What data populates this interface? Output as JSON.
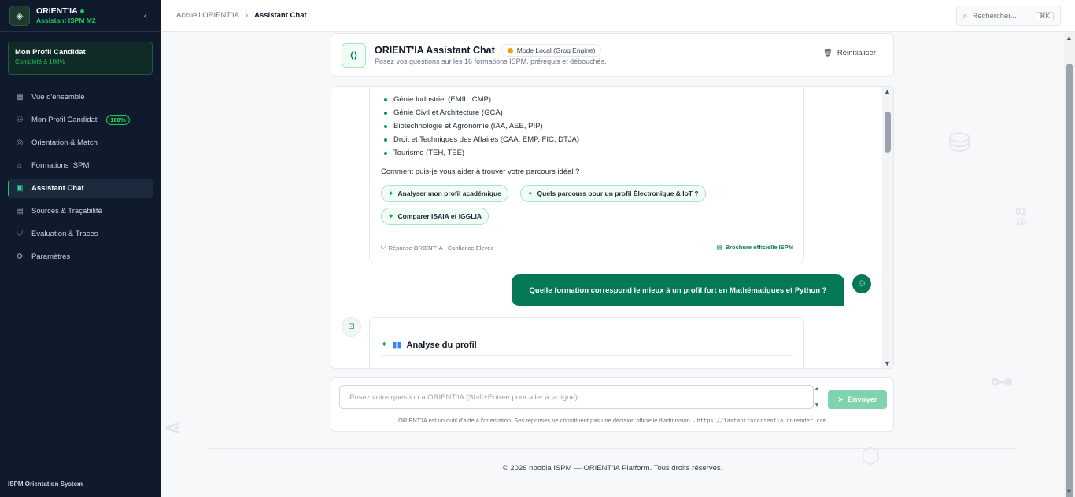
{
  "sidebar": {
    "brand_name": "ORIENT'IA",
    "brand_sub": "Assistant ISPM M2",
    "profile_card_title": "Mon Profil Candidat",
    "profile_card_sub": "Complété à 100%",
    "items": [
      {
        "label": "Vue d'ensemble",
        "icon": "grid-icon"
      },
      {
        "label": "Mon Profil Candidat",
        "icon": "user-icon",
        "badge": "100%"
      },
      {
        "label": "Orientation & Match",
        "icon": "compass-icon"
      },
      {
        "label": "Formations ISPM",
        "icon": "graduation-cap-icon"
      },
      {
        "label": "Assistant Chat",
        "icon": "chat-icon",
        "active": true
      },
      {
        "label": "Sources & Traçabilité",
        "icon": "book-icon"
      },
      {
        "label": "Évaluation & Traces",
        "icon": "shield-check-icon"
      },
      {
        "label": "Paramètres",
        "icon": "gear-icon"
      }
    ],
    "footer": "ISPM Orientation System"
  },
  "topbar": {
    "breadcrumb_home": "Accueil ORIENT'IA",
    "breadcrumb_current": "Assistant Chat",
    "search_placeholder": "Rechercher...",
    "search_shortcut": "⌘K"
  },
  "chat_header": {
    "title": "ORIENT'IA Assistant Chat",
    "mode": "Mode Local (Groq Engine)",
    "subtitle": "Posez vos questions sur les 16 formations ISPM, prérequis et débouchés.",
    "reset_label": "Réinitialiser"
  },
  "messages": {
    "bot_list": [
      "Génie Industriel (EMII, ICMP)",
      "Génie Civil et Architecture (GCA)",
      "Biotechnologie et Agronomie (IAA, AEE, PIP)",
      "Droit et Techniques des Affaires (CAA, EMP, FIC, DTJA)",
      "Tourisme (TEH, TEE)"
    ],
    "bot_question": "Comment puis-je vous aider à trouver votre parcours idéal ?",
    "chips": [
      "Analyser mon profil académique",
      "Quels parcours pour un profil Électronique & IoT ?",
      "Comparer ISAIA et IGGLIA"
    ],
    "bot_meta": "Réponse ORIENT'IA · Confiance Élevée",
    "bot_source": "Brochure officielle ISPM",
    "user_message": "Quelle formation correspond le mieux à un profil fort en Mathématiques et Python ?",
    "analysis_title": "Analyse du profil"
  },
  "composer": {
    "placeholder": "Posez votre question à ORIENT'IA (Shift+Entrée pour aller à la ligne)...",
    "send_label": "Envoyer",
    "disclaimer": "ORIENT'IA est un outil d'aide à l'orientation. Ses réponses ne constituent pas une décision officielle d'admission. · ",
    "disclaimer_url": "https://fastapifororientia.onrender.com"
  },
  "footer": "© 2026 noobia ISPM — ORIENT'IA Platform. Tous droits réservés.",
  "colors": {
    "sidebar_bg": "#0f1b2d",
    "accent": "#047857",
    "accent_light": "#22c55e",
    "mode_dot": "#f59e0b"
  }
}
